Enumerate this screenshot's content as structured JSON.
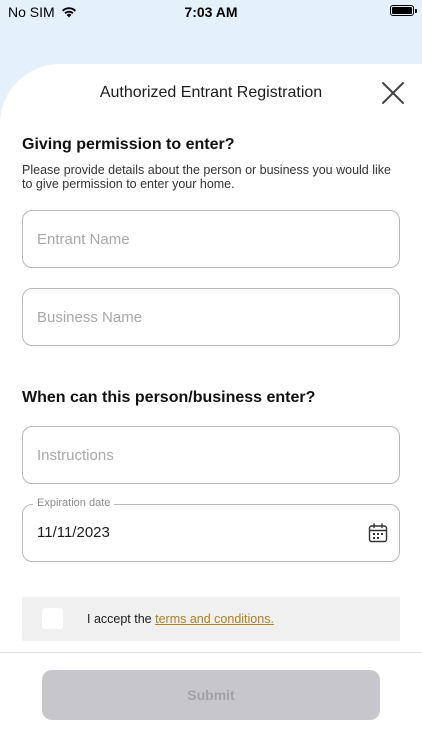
{
  "status_bar": {
    "carrier": "No SIM",
    "time": "7:03 AM"
  },
  "sheet": {
    "title": "Authorized Entrant Registration"
  },
  "permission_section": {
    "title": "Giving permission to enter?",
    "description": "Please provide details about the person or business you would like to give permission to enter your home."
  },
  "fields": {
    "entrant_name": {
      "placeholder": "Entrant Name",
      "value": ""
    },
    "business_name": {
      "placeholder": "Business Name",
      "value": ""
    },
    "instructions": {
      "placeholder": "Instructions",
      "value": ""
    },
    "expiration_date": {
      "label": "Expiration date",
      "value": "11/11/2023"
    }
  },
  "when_section": {
    "title": "When can this person/business enter?"
  },
  "terms": {
    "prefix": "I accept the ",
    "link": "terms and conditions.",
    "checked": false
  },
  "submit": {
    "label": "Submit",
    "enabled": false
  },
  "colors": {
    "background": "#e4f1fb",
    "link": "#b07f1f",
    "submit_disabled_bg": "#c6c6cc",
    "submit_disabled_text": "#a2a2a8"
  }
}
